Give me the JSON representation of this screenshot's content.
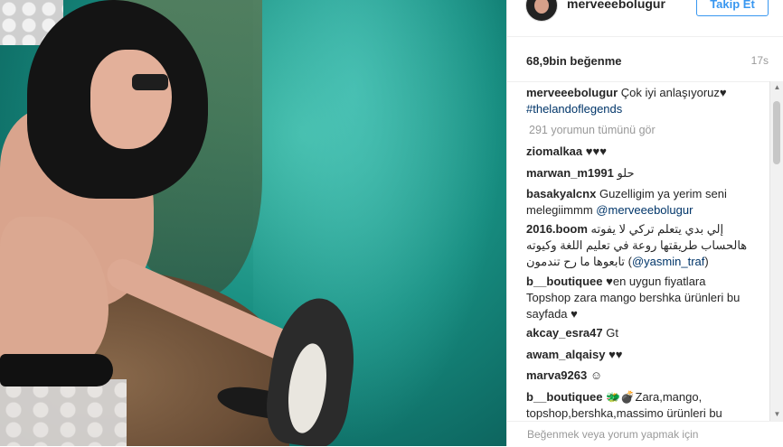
{
  "post": {
    "username": "merveeebolugur",
    "follow_label": "Takip Et",
    "likes": "68,9bin beğenme",
    "time": "17s"
  },
  "caption": {
    "username": "merveeebolugur",
    "text": "Çok iyi anlaşıyoruz",
    "heart": "♥",
    "hashtag": "#thelandoflegends"
  },
  "view_all_comments": "291 yorumun tümünü gör",
  "comments": [
    {
      "user": "ziomalkaa",
      "text": "♥♥♥"
    },
    {
      "user": "marwan_m1991",
      "text": "حلو"
    },
    {
      "user": "basakyalcnx",
      "text": "Guzelligim ya yerim seni melegiimmm",
      "mention": "@merveeebolugur"
    },
    {
      "user": "2016.boom",
      "text": "إلي بدي يتعلم تركي لا يفوته هالحساب طريقتها روعة في تعليم اللغة وكيوته تابعوها ما رح تندمون",
      "mention": "@yasmin_traf"
    },
    {
      "user": "b__boutiquee",
      "text": "♥en uygun fiyatlara Topshop zara mango bershka ürünleri bu sayfada ♥"
    },
    {
      "user": "akcay_esra47",
      "text": "Gt"
    },
    {
      "user": "awam_alqaisy",
      "text": "♥♥"
    },
    {
      "user": "marva9263",
      "text": "☺"
    },
    {
      "user": "b__boutiquee",
      "text": "🐲💣Zara,mango, topshop,bershka,massimo ürünleri bu"
    }
  ],
  "add_comment": {
    "placeholder": "Beğenmek veya yorum yapmak için"
  }
}
